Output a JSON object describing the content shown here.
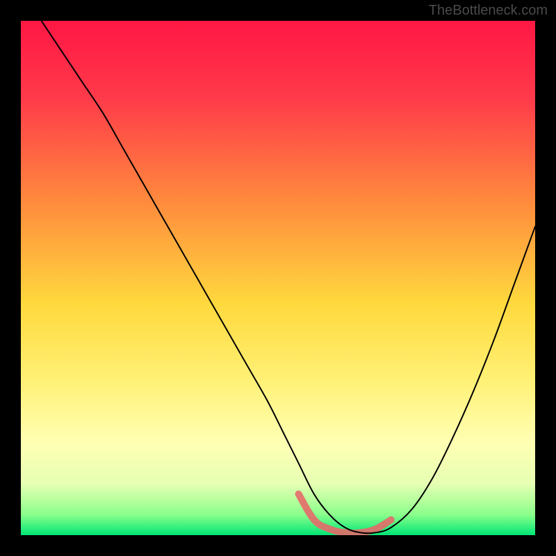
{
  "watermark": "TheBottleneck.com",
  "chart_data": {
    "type": "line",
    "title": "",
    "xlabel": "",
    "ylabel": "",
    "xlim": [
      0,
      100
    ],
    "ylim": [
      0,
      100
    ],
    "background_gradient": {
      "stops": [
        {
          "pos": 0.0,
          "color": "#ff1744"
        },
        {
          "pos": 0.15,
          "color": "#ff3a4a"
        },
        {
          "pos": 0.35,
          "color": "#ff8a3d"
        },
        {
          "pos": 0.55,
          "color": "#ffd93d"
        },
        {
          "pos": 0.7,
          "color": "#fff176"
        },
        {
          "pos": 0.82,
          "color": "#ffffb3"
        },
        {
          "pos": 0.9,
          "color": "#e6ffb3"
        },
        {
          "pos": 0.96,
          "color": "#8bff8b"
        },
        {
          "pos": 1.0,
          "color": "#00e676"
        }
      ]
    },
    "series": [
      {
        "name": "bottleneck-curve",
        "color": "#000000",
        "width": 2,
        "x": [
          4,
          8,
          12,
          16,
          20,
          24,
          28,
          32,
          36,
          40,
          44,
          48,
          51,
          54,
          57,
          60,
          63,
          66,
          69,
          72,
          76,
          80,
          84,
          88,
          92,
          96,
          100
        ],
        "y": [
          100,
          94,
          88,
          82,
          75,
          68,
          61,
          54,
          47,
          40,
          33,
          26,
          20,
          14,
          8,
          4,
          1.5,
          0.5,
          0.5,
          1.5,
          5,
          11,
          19,
          28,
          38,
          49,
          60
        ]
      },
      {
        "name": "highlight-band",
        "color": "#e66a6a",
        "width": 10,
        "x": [
          54,
          57,
          60,
          63,
          66,
          69,
          72
        ],
        "y": [
          8,
          3,
          1.2,
          0.5,
          0.5,
          1.2,
          3
        ]
      }
    ]
  }
}
